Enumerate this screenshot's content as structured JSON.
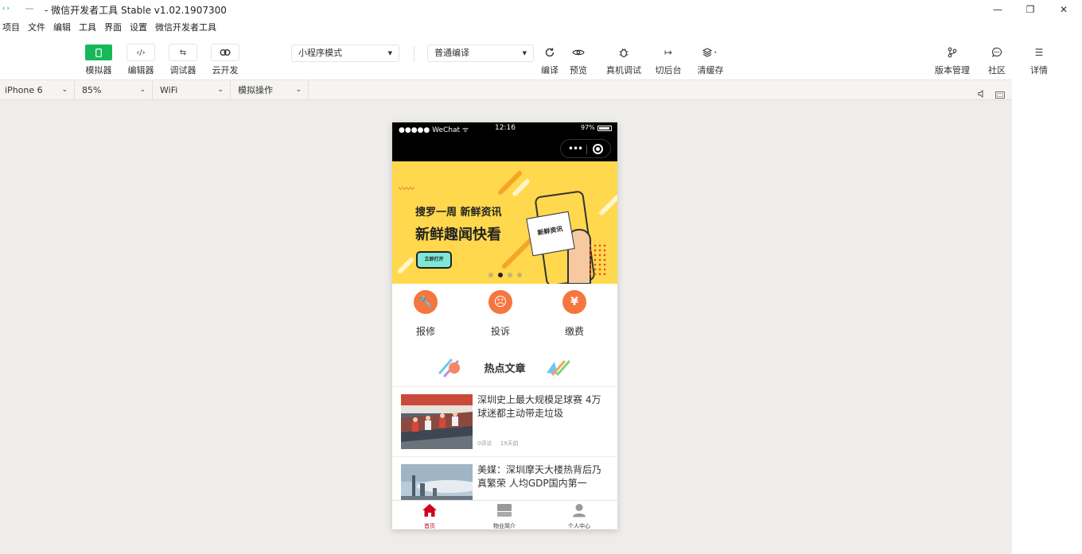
{
  "window": {
    "title": "- 微信开发者工具 Stable v1.02.1907300",
    "controls": {
      "minimize": "—",
      "maximize": "❐",
      "close": "✕"
    }
  },
  "menu": [
    "项目",
    "文件",
    "编辑",
    "工具",
    "界面",
    "设置",
    "微信开发者工具"
  ],
  "toolbar": {
    "simulator": "模拟器",
    "editor": "编辑器",
    "debugger": "调试器",
    "cloud": "云开发",
    "mode_select": "小程序模式",
    "compile_select": "普通编译",
    "compile": "编译",
    "preview": "预览",
    "remote_debug": "真机调试",
    "background": "切后台",
    "clear_cache": "清缓存",
    "version": "版本管理",
    "community": "社区",
    "details": "详情"
  },
  "devicebar": {
    "device": "iPhone 6",
    "zoom": "85%",
    "network": "WiFi",
    "sim_action": "模拟操作"
  },
  "phone": {
    "status": {
      "carrier": "●●●●● WeChat ᯤ",
      "time": "12:16",
      "battery": "97%"
    },
    "capsule_dots": "•••",
    "banner": {
      "line1": "搜罗一周 新鲜资讯",
      "line2": "新鲜趣闻快看",
      "button": "立即打开",
      "card_text": "新鲜资讯",
      "squiggle": "〰〰",
      "indicator_active": 1,
      "indicator_count": 4
    },
    "services": [
      {
        "label": "报修",
        "icon": "wrench-icon",
        "glyph": "🔧"
      },
      {
        "label": "投诉",
        "icon": "complaint-face-icon",
        "glyph": "☹"
      },
      {
        "label": "缴费",
        "icon": "payment-bag-icon",
        "glyph": "¥"
      }
    ],
    "hot_title": "热点文章",
    "articles": [
      {
        "title": "深圳史上最大规模足球赛 4万球迷都主动带走垃圾",
        "comments": "0评论",
        "time": "19天前"
      },
      {
        "title": "美媒：深圳摩天大楼热背后乃真繁荣 人均GDP国内第一",
        "comments": "",
        "time": ""
      }
    ],
    "tabs": [
      {
        "label": "首页",
        "icon": "home-icon",
        "active": true
      },
      {
        "label": "物业简介",
        "icon": "building-icon",
        "active": false
      },
      {
        "label": "个人中心",
        "icon": "person-icon",
        "active": false
      }
    ]
  },
  "colors": {
    "active_green": "#17b85a",
    "banner_yellow": "#ffd84d",
    "service_orange": "#f5763e",
    "tab_active_red": "#d0021b"
  }
}
